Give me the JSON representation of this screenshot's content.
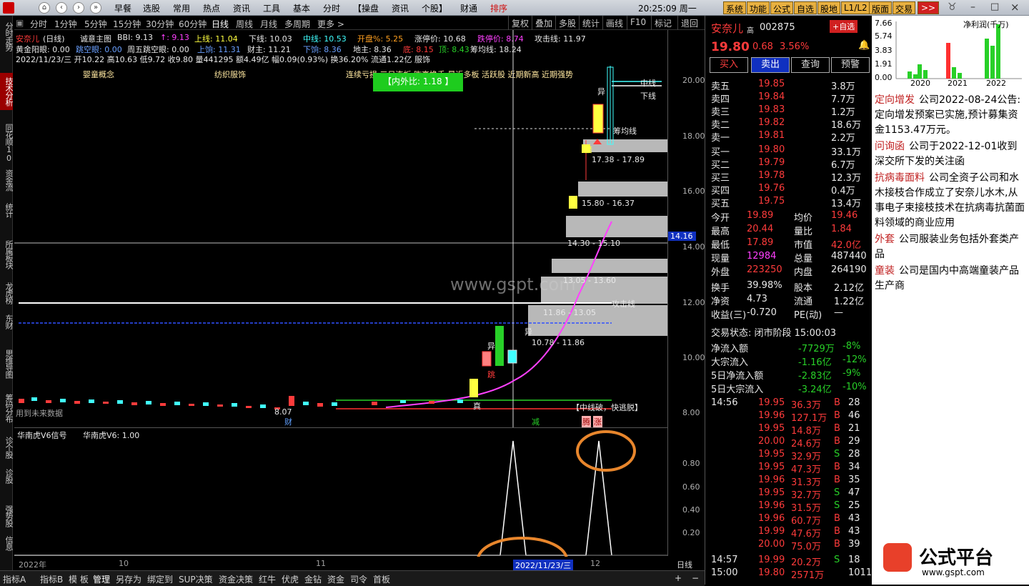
{
  "topbar": {
    "menus": [
      "早餐",
      "选股",
      "常用",
      "热点",
      "资讯",
      "工具",
      "基本",
      "分时",
      "【操盘",
      "资讯",
      "个股】",
      "财通",
      "排序"
    ],
    "clock": "20:25:09 周一",
    "buttons": [
      "系统",
      "功能",
      "公式",
      "自选",
      "股地",
      "L1/L2",
      "版面",
      "交易",
      ">>"
    ]
  },
  "leftnav": [
    "分时走势",
    "技术分析",
    "同花顺10",
    "资金流",
    "统计",
    "所属板块",
    "龙虎榜",
    "东财",
    "思维导图",
    "筹码分布",
    "诊个股",
    "诊股",
    "强势股",
    "信息"
  ],
  "periods": [
    "分时",
    "1分钟",
    "5分钟",
    "15分钟",
    "30分钟",
    "60分钟",
    "日线",
    "周线",
    "月线",
    "多周期",
    "更多 >"
  ],
  "toolbar_right": [
    "复权",
    "叠加",
    "多股",
    "统计",
    "画线",
    "F10",
    "标记",
    "退回"
  ],
  "indicators": {
    "line1": {
      "name": "安奈儿",
      "period": "(日线)",
      "tpl": "诚意主图",
      "bbi": "BBI: 9.13",
      "bbi2": "↑: 9.13",
      "upper": "上线: 11.04",
      "lower": "下线: 10.03",
      "mid": "中线: 10.53",
      "open": "开盘%: 5.25",
      "limitup": "涨停价: 10.68",
      "limitdown": "跌停价: 8.74",
      "attack": "攻击线: 11.97"
    },
    "line2": {
      "a": "黄金阳眼: 0.00",
      "b": "跳空眼: 0.00",
      "c": "周五跳空眼: 0.00",
      "d": "上饷: 11.31",
      "e": "财主: 11.21",
      "f": "下饷: 8.36",
      "g": "地主: 8.36",
      "h": "底: 8.15",
      "i": "顶: 8.43",
      "j": "筹均线: 18.24"
    },
    "line3": "2022/11/23/三 开10.22 高10.63 低9.72 收9.80 量441295 额4.49亿 幅0.09(0.93%) 换36.20% 流通1.22亿 服饰",
    "concepts": [
      "婴童概念",
      "纺织服饰",
      "连续亏损 三日连板 昨高换手 最近多板 活跃股 近期新高 近期强势"
    ]
  },
  "chart_labels": {
    "inner_outer": "【内外比: 1.18 】",
    "zhongxian": "中线",
    "xiaxian": "下线",
    "choujunxian": "筹均线",
    "gongjixian": "攻击线",
    "watermark": "www.gspt.com",
    "zhongxian_po": "【中线破，快逃脱】",
    "future": "用到未来数据",
    "price_marker": "14.16",
    "yi1": "异",
    "yi2": "异",
    "yi3": "异",
    "bei": "倍",
    "tiao": "跳",
    "zhen": "真",
    "cai": "财",
    "jian": "减",
    "teng": "腾",
    "zhang": "涨",
    "low_mark": "8.07",
    "zones": [
      "17.38 - 17.89",
      "15.80 - 16.37",
      "14.30 - 15.10",
      "13.05 - 13.60",
      "11.86 - 13.05",
      "10.78 - 11.86"
    ]
  },
  "axis": {
    "ticks": [
      "20.00",
      "18.00",
      "16.00",
      "14.00",
      "12.00",
      "10.00",
      "8.00"
    ],
    "sub_ticks": [
      "0.80",
      "0.60",
      "0.40",
      "0.20"
    ],
    "bottom": "日线"
  },
  "subchart": {
    "title": "华南虎V6信号",
    "value": "华南虎V6: 1.00",
    "date_label": "2022/11/23/三",
    "xlabels": [
      "2022年",
      "10",
      "11",
      "12"
    ]
  },
  "quote": {
    "name": "安奈儿",
    "tag": "高",
    "code": "002875",
    "add_btn": "+自选",
    "price": "19.80",
    "change": "0.68",
    "pct": "3.56%",
    "actions": [
      "买入",
      "卖出",
      "查询",
      "预警"
    ],
    "asks": [
      [
        "卖五",
        "19.85",
        "3.8万"
      ],
      [
        "卖四",
        "19.84",
        "7.7万"
      ],
      [
        "卖三",
        "19.83",
        "1.2万"
      ],
      [
        "卖二",
        "19.82",
        "18.6万"
      ],
      [
        "卖一",
        "19.81",
        "2.2万"
      ]
    ],
    "bids": [
      [
        "买一",
        "19.80",
        "33.1万"
      ],
      [
        "买二",
        "19.79",
        "6.7万"
      ],
      [
        "买三",
        "19.78",
        "12.3万"
      ],
      [
        "买四",
        "19.76",
        "0.4万"
      ],
      [
        "买五",
        "19.75",
        "13.4万"
      ]
    ],
    "stats": [
      [
        "今开",
        "19.89",
        "均价",
        "19.46"
      ],
      [
        "最高",
        "20.44",
        "量比",
        "1.84"
      ],
      [
        "最低",
        "17.89",
        "市值",
        "42.0亿"
      ],
      [
        "现量",
        "12984",
        "总量",
        "487440"
      ],
      [
        "外盘",
        "223250",
        "内盘",
        "264190"
      ]
    ],
    "stats2": [
      [
        "换手",
        "39.98%",
        "股本",
        "2.12亿"
      ],
      [
        "净资",
        "4.73",
        "流通",
        "1.22亿"
      ],
      [
        "收益(三)",
        "-0.720",
        "PE(动)",
        "—"
      ]
    ],
    "trade_state": "交易状态: 闭市阶段 15:00:03",
    "flows": [
      [
        "净流入额",
        "-7729万",
        "-8%"
      ],
      [
        "大宗流入",
        "-1.16亿",
        "-12%"
      ],
      [
        "5日净流入额",
        "-2.83亿",
        "-9%"
      ],
      [
        "5日大宗流入",
        "-3.24亿",
        "-10%"
      ]
    ],
    "ticks": [
      [
        "14:56",
        "19.95",
        "36.3万",
        "B",
        "28"
      ],
      [
        "",
        "19.96",
        "127.1万",
        "B",
        "46"
      ],
      [
        "",
        "19.95",
        "14.8万",
        "B",
        "21"
      ],
      [
        "",
        "20.00",
        "24.6万",
        "B",
        "29"
      ],
      [
        "",
        "19.95",
        "32.9万",
        "S",
        "28"
      ],
      [
        "",
        "19.95",
        "47.3万",
        "B",
        "34"
      ],
      [
        "",
        "19.96",
        "31.3万",
        "B",
        "35"
      ],
      [
        "",
        "19.95",
        "32.7万",
        "S",
        "47"
      ],
      [
        "",
        "19.96",
        "31.5万",
        "S",
        "25"
      ],
      [
        "",
        "19.96",
        "60.7万",
        "B",
        "43"
      ],
      [
        "",
        "19.99",
        "47.6万",
        "B",
        "43"
      ],
      [
        "",
        "20.00",
        "75.0万",
        "B",
        "39"
      ],
      [
        "14:57",
        "19.99",
        "20.2万",
        "S",
        "18"
      ],
      [
        "15:00",
        "19.80",
        "2571万",
        "",
        "1011"
      ]
    ]
  },
  "info": {
    "chart_title": "净利润(千万)",
    "chart_ticks": [
      "7.66",
      "5.74",
      "3.83",
      "1.91",
      "0.00"
    ],
    "years": [
      "2020",
      "2021",
      "2022"
    ],
    "items": [
      {
        "tag": "定向增发",
        "text": "公司2022-08-24公告:定向增发预案已实施,预计募集资金1153.47万元。"
      },
      {
        "tag": "问询函",
        "text": "公司于2022-12-01收到深交所下发的关注函"
      },
      {
        "tag": "抗病毒面料",
        "text": "公司全资子公司和水木接枝合作成立了安奈儿水木,从事电子束接枝技术在抗病毒抗菌面料领域的商业应用"
      },
      {
        "tag": "外套",
        "text": "公司服装业务包括外套类产品"
      },
      {
        "tag": "童装",
        "text": "公司是国内中高端童装产品生产商"
      }
    ],
    "logo_text": "公式平台",
    "logo_url": "www.gspt.com"
  },
  "bottombar": [
    "指标A",
    "指标B",
    "模 板",
    "管理",
    "另存为",
    "绑定到",
    "SUP决策",
    "资金决策",
    "红牛",
    "伏虎",
    "金钻",
    "资金",
    "司令",
    "首板"
  ],
  "colors": {
    "up": "#ff3b3b",
    "down": "#28d028",
    "accent": "#ffff40",
    "magenta": "#ff40ff",
    "zone": "#b0b0b0"
  }
}
